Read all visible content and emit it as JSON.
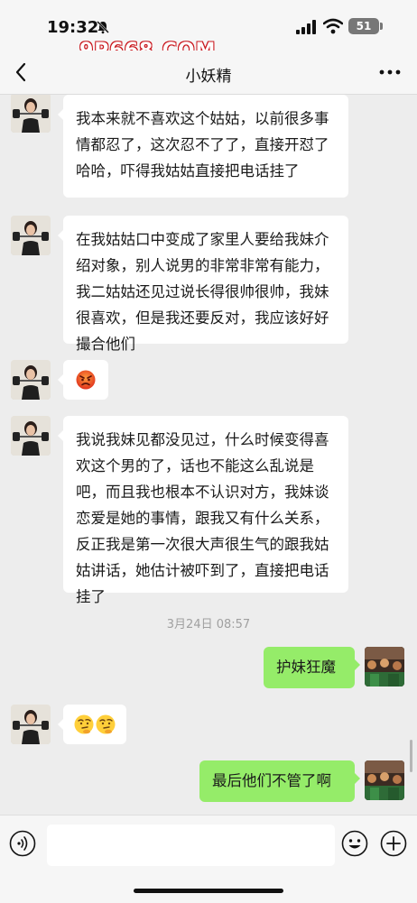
{
  "status": {
    "time": "19:32",
    "battery": "51",
    "icons": [
      "silent-bell-icon",
      "signal-icon",
      "wifi-icon",
      "battery-icon"
    ]
  },
  "watermark": {
    "text": "9P668.COM",
    "color": "#c9161c"
  },
  "header": {
    "title": "小妖精",
    "back_icon": "chevron-left-icon",
    "more_icon": "more-dots-icon"
  },
  "messages": [
    {
      "side": "left",
      "text": "我本来就不喜欢这个姑姑，以前很多事情都忍了，这次忍不了了，直接开怼了哈哈，吓得我姑姑直接把电话挂了"
    },
    {
      "side": "left",
      "text": "在我姑姑口中变成了家里人要给我妹介绍对象，别人说男的非常非常有能力，我二姑姑还见过说长得很帅很帅，我妹很喜欢，但是我还要反对，我应该好好撮合他们"
    },
    {
      "side": "left",
      "emoji": [
        "angry-face-icon"
      ]
    },
    {
      "side": "left",
      "text": "我说我妹见都没见过，什么时候变得喜欢这个男的了，话也不能这么乱说是吧，而且我也根本不认识对方，我妹谈恋爱是她的事情，跟我又有什么关系，反正我是第一次很大声很生气的跟我姑姑讲话，她估计被吓到了，直接把电话挂了"
    },
    {
      "side": "right",
      "text": "护妹狂魔"
    },
    {
      "side": "left",
      "emoji": [
        "thinking-face-icon",
        "thinking-face-icon"
      ]
    },
    {
      "side": "right",
      "text": "最后他们不管了啊"
    }
  ],
  "timestamp": "3月24日 08:57",
  "input_bar": {
    "voice_icon": "voice-icon",
    "emoji_icon": "emoji-icon",
    "plus_icon": "plus-icon"
  },
  "colors": {
    "chat_background": "#ededed",
    "bubble_self": "#95ec69",
    "bubble_other": "#ffffff"
  }
}
